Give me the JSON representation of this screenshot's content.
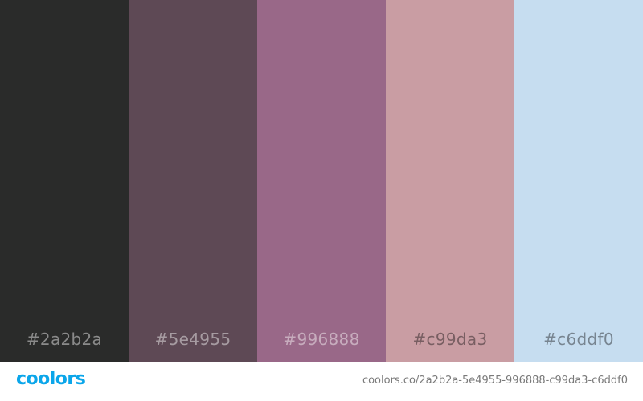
{
  "palette": {
    "swatches": [
      {
        "hex": "#2a2b2a",
        "label": "#2a2b2a"
      },
      {
        "hex": "#5e4955",
        "label": "#5e4955"
      },
      {
        "hex": "#996888",
        "label": "#996888"
      },
      {
        "hex": "#c99da3",
        "label": "#c99da3"
      },
      {
        "hex": "#c6ddf0",
        "label": "#c6ddf0"
      }
    ]
  },
  "footer": {
    "logo_text": "coolors",
    "logo_color": "#0ba6ea",
    "url": "coolors.co/2a2b2a-5e4955-996888-c99da3-c6ddf0"
  }
}
